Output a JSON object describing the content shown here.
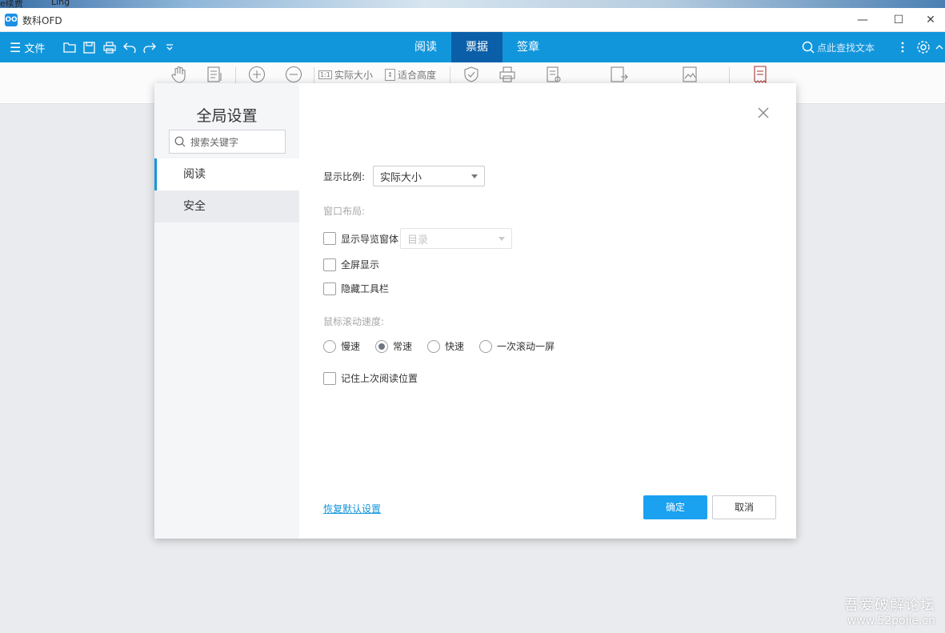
{
  "desktop": {
    "left_text": "e续费",
    "center_text": "Ling"
  },
  "window": {
    "app_icon_text": "OO",
    "title": "数科OFD",
    "controls": {
      "minimize": "—",
      "maximize": "☐",
      "close": "✕"
    }
  },
  "menubar": {
    "file_label": "文件",
    "tabs": [
      {
        "label": "阅读"
      },
      {
        "label": "票据"
      },
      {
        "label": "签章"
      }
    ],
    "active_tab": "票据",
    "search_placeholder": "点此查找文本"
  },
  "toolbar": {
    "actual_size_label": "实际大小",
    "fit_height_label": "适合高度",
    "actual_size_badge": "1:1"
  },
  "dialog": {
    "title": "全局设置",
    "search_placeholder": "搜索关键字",
    "nav": [
      {
        "label": "阅读",
        "active": true
      },
      {
        "label": "安全",
        "active": false
      }
    ],
    "display_ratio_label": "显示比例:",
    "display_ratio_value": "实际大小",
    "window_layout_label": "窗口布局:",
    "show_nav_pane_label": "显示导览窗体",
    "nav_pane_select_value": "目录",
    "fullscreen_label": "全屏显示",
    "hide_toolbar_label": "隐藏工具栏",
    "scroll_speed_label": "鼠标滚动速度:",
    "scroll_options": [
      {
        "label": "慢速",
        "checked": false
      },
      {
        "label": "常速",
        "checked": true
      },
      {
        "label": "快速",
        "checked": false
      },
      {
        "label": "一次滚动一屏",
        "checked": false
      }
    ],
    "remember_position_label": "记住上次阅读位置",
    "reset_label": "恢复默认设置",
    "ok_label": "确定",
    "cancel_label": "取消"
  },
  "watermark": {
    "line1": "吾爱破解论坛",
    "line2": "www.52pojie.cn"
  },
  "colors": {
    "accent": "#1296db",
    "tab_active": "#0b5fa8",
    "primary_button": "#1aa1f0"
  }
}
